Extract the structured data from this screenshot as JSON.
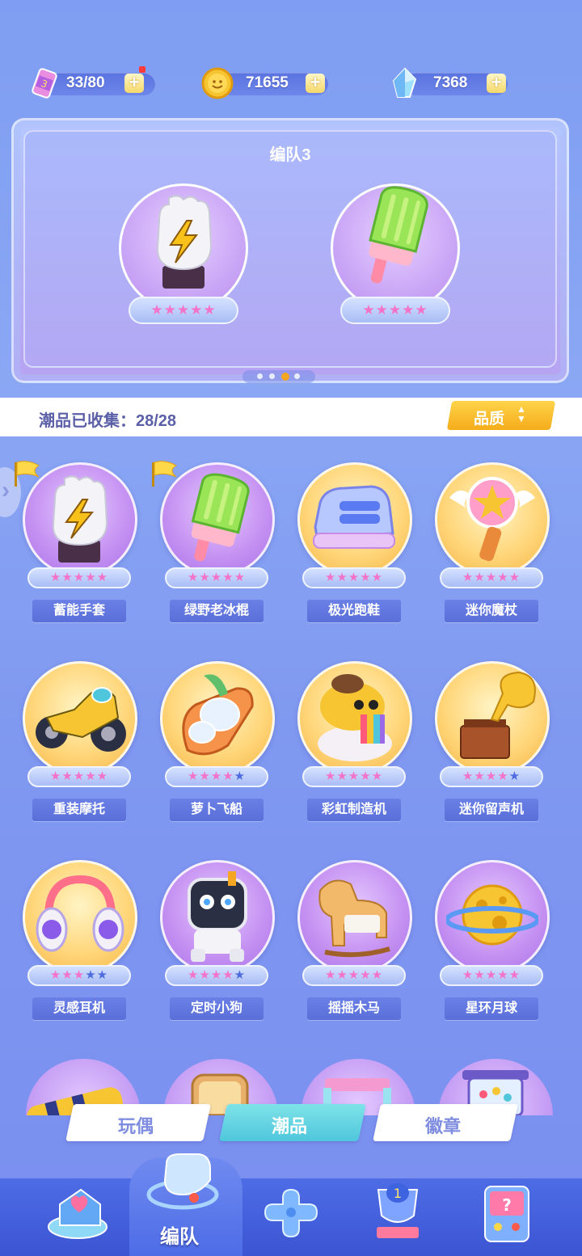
{
  "resources": {
    "energy": {
      "value": "33/80",
      "icon": "energy-can-icon"
    },
    "coins": {
      "value": "71655",
      "icon": "coin-icon"
    },
    "gems": {
      "value": "7368",
      "icon": "crystal-icon"
    }
  },
  "team": {
    "title": "编队3",
    "slots": [
      {
        "item": "蓄能手套",
        "stars": "★★★★★"
      },
      {
        "item": "绿野老冰棍",
        "stars": "★★★★★"
      }
    ],
    "page_count": 4,
    "active_page": 3
  },
  "collection": {
    "label": "潮品已收集：28/28",
    "sort_label": "品质"
  },
  "items": [
    {
      "name": "蓄能手套",
      "stars_full": "★★★★★",
      "stars_dim": "",
      "bg": "purple",
      "flag": true
    },
    {
      "name": "绿野老冰棍",
      "stars_full": "★★★★★",
      "stars_dim": "",
      "bg": "purple",
      "flag": true
    },
    {
      "name": "极光跑鞋",
      "stars_full": "★★★★★",
      "stars_dim": "",
      "bg": "gold",
      "flag": false
    },
    {
      "name": "迷你魔杖",
      "stars_full": "★★★★★",
      "stars_dim": "",
      "bg": "gold",
      "flag": false
    },
    {
      "name": "重装摩托",
      "stars_full": "★★★★★",
      "stars_dim": "",
      "bg": "gold",
      "flag": false
    },
    {
      "name": "萝卜飞船",
      "stars_full": "★★★★",
      "stars_dim": "★",
      "bg": "gold",
      "flag": false
    },
    {
      "name": "彩虹制造机",
      "stars_full": "★★★★★",
      "stars_dim": "",
      "bg": "gold",
      "flag": false
    },
    {
      "name": "迷你留声机",
      "stars_full": "★★★★",
      "stars_dim": "★",
      "bg": "gold",
      "flag": false
    },
    {
      "name": "灵感耳机",
      "stars_full": "★★★",
      "stars_dim": "★★",
      "bg": "gold",
      "flag": false
    },
    {
      "name": "定时小狗",
      "stars_full": "★★★★",
      "stars_dim": "★",
      "bg": "purple",
      "flag": false
    },
    {
      "name": "摇摇木马",
      "stars_full": "★★★★★",
      "stars_dim": "",
      "bg": "purple",
      "flag": false
    },
    {
      "name": "星环月球",
      "stars_full": "★★★★★",
      "stars_dim": "",
      "bg": "purple",
      "flag": false
    }
  ],
  "tabs": [
    {
      "label": "玩偶",
      "active": false
    },
    {
      "label": "潮品",
      "active": true
    },
    {
      "label": "徽章",
      "active": false
    }
  ],
  "nav": {
    "active_label": "编队",
    "items": [
      "home-icon",
      "whistle-icon",
      "gamepad-icon",
      "trophy-icon",
      "arcade-icon"
    ]
  },
  "colors": {
    "accent": "#f5ac1a",
    "star": "#f373c8",
    "active_tab": "#4fc6dc"
  }
}
